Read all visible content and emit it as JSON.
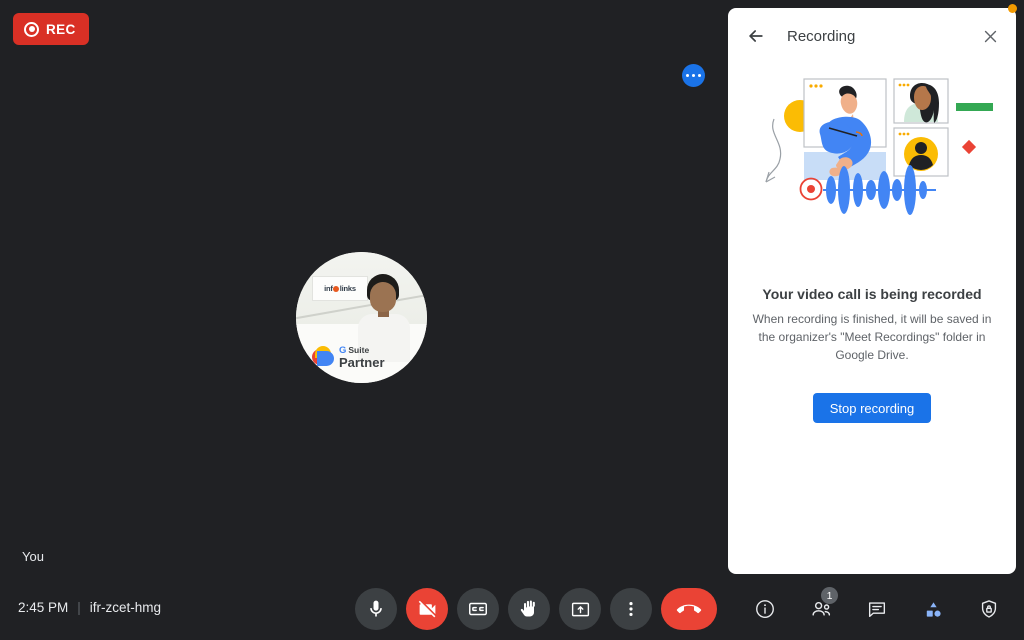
{
  "recording_badge": {
    "label": "REC",
    "icon": "record-dot-icon",
    "color": "#d93025"
  },
  "stage": {
    "self_label": "You",
    "tile_more_icon": "more-dots-icon",
    "avatar": {
      "sign_text_left": "inf",
      "sign_text_right": "links",
      "brand_g": "G",
      "brand_suite": "Suite",
      "brand_partner": "Partner"
    }
  },
  "bottom_bar": {
    "time": "2:45 PM",
    "separator": "|",
    "meeting_code": "ifr-zcet-hmg",
    "controls": [
      {
        "name": "microphone-button",
        "icon": "microphone-icon",
        "state": "on"
      },
      {
        "name": "camera-button",
        "icon": "camera-off-icon",
        "state": "off"
      },
      {
        "name": "captions-button",
        "icon": "closed-caption-icon",
        "state": "on"
      },
      {
        "name": "raise-hand-button",
        "icon": "raised-hand-icon",
        "state": "on"
      },
      {
        "name": "present-screen-button",
        "icon": "present-screen-icon",
        "state": "on"
      },
      {
        "name": "more-options-button",
        "icon": "more-vertical-icon",
        "state": "on"
      },
      {
        "name": "leave-call-button",
        "icon": "phone-hangup-icon",
        "state": "danger"
      }
    ],
    "right_icons": [
      {
        "name": "meeting-details-button",
        "icon": "info-icon"
      },
      {
        "name": "participants-button",
        "icon": "people-icon",
        "badge": "1"
      },
      {
        "name": "chat-button",
        "icon": "chat-icon"
      },
      {
        "name": "activities-button",
        "icon": "activities-shapes-icon"
      },
      {
        "name": "host-controls-button",
        "icon": "shield-lock-icon"
      }
    ]
  },
  "panel": {
    "back_icon": "arrow-back-icon",
    "title": "Recording",
    "close_icon": "close-icon",
    "heading": "Your video call is being recorded",
    "body": "When recording is finished, it will be saved in the organizer's \"Meet Recordings\" folder in Google Drive.",
    "stop_button": "Stop recording",
    "illustration": {
      "name": "recording-illustration",
      "record_icon": "record-circle-icon",
      "waveform_icon": "audio-waveform-icon",
      "green_bar_color": "#34a853",
      "red_diamond_color": "#ea4335",
      "yellow_circle_color": "#fbbc04",
      "blue_color": "#4285f4"
    }
  },
  "corner_dot": {
    "name": "notification-dot",
    "color": "#f29900"
  }
}
